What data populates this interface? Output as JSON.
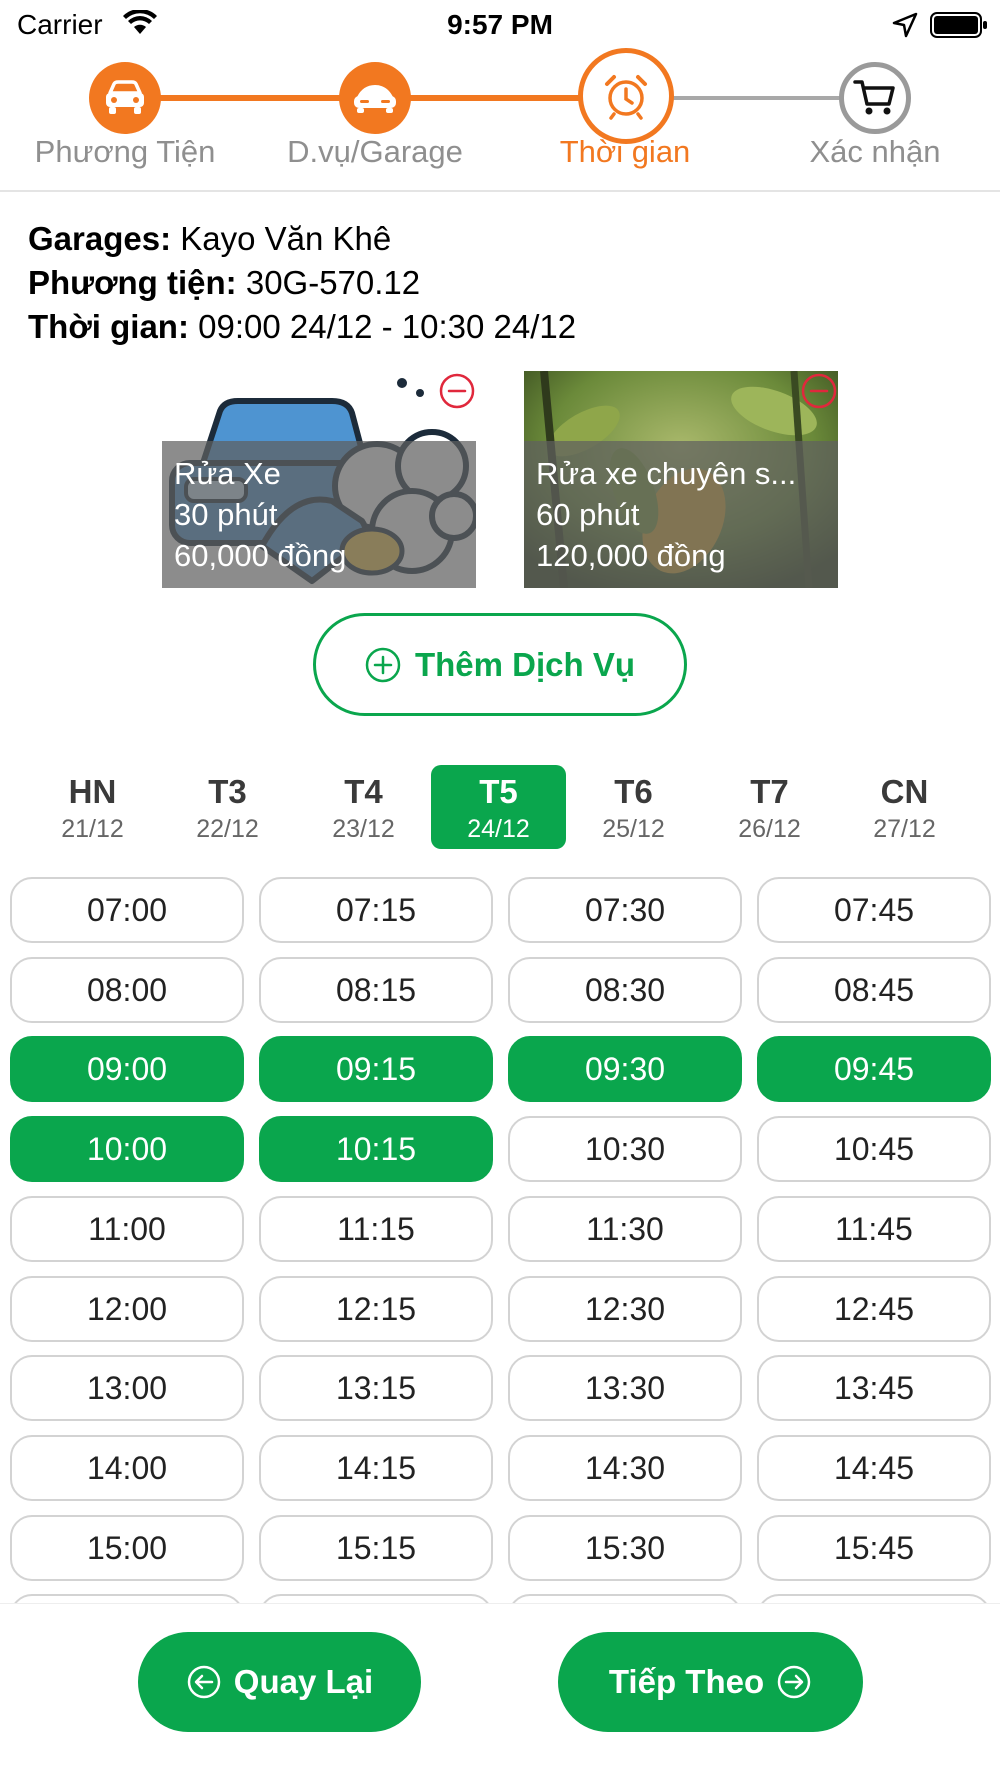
{
  "status_bar": {
    "carrier": "Carrier",
    "time": "9:57 PM"
  },
  "stepper": {
    "steps": [
      {
        "label": "Phương Tiện",
        "icon": "car-icon",
        "state": "done"
      },
      {
        "label": "D.vụ/Garage",
        "icon": "car-service-icon",
        "state": "done"
      },
      {
        "label": "Thời gian",
        "icon": "alarm-clock-icon",
        "state": "active"
      },
      {
        "label": "Xác nhận",
        "icon": "cart-icon",
        "state": "pending"
      }
    ],
    "colors": {
      "active": "#f27820",
      "pending": "#9a9a9a"
    }
  },
  "summary": {
    "garage_key": "Garages:",
    "garage_value": " Kayo Văn Khê",
    "vehicle_key": "Phương tiện:",
    "vehicle_value": " 30G-570.12",
    "time_key": "Thời gian:",
    "time_value": " 09:00 24/12 - 10:30 24/12"
  },
  "services": [
    {
      "name": "Rửa Xe",
      "duration": "30 phút",
      "price": "60,000 đồng",
      "image": "car-wash-illustration"
    },
    {
      "name": "Rửa xe chuyên s...",
      "duration": "60 phút",
      "price": "120,000 đồng",
      "image": "leaf-photo"
    }
  ],
  "add_service_label": "Thêm Dịch Vụ",
  "days": [
    {
      "name": "HN",
      "date": "21/12",
      "selected": false
    },
    {
      "name": "T3",
      "date": "22/12",
      "selected": false
    },
    {
      "name": "T4",
      "date": "23/12",
      "selected": false
    },
    {
      "name": "T5",
      "date": "24/12",
      "selected": true
    },
    {
      "name": "T6",
      "date": "25/12",
      "selected": false
    },
    {
      "name": "T7",
      "date": "26/12",
      "selected": false
    },
    {
      "name": "CN",
      "date": "27/12",
      "selected": false
    }
  ],
  "time_slots": [
    {
      "time": "07:00",
      "selected": false
    },
    {
      "time": "07:15",
      "selected": false
    },
    {
      "time": "07:30",
      "selected": false
    },
    {
      "time": "07:45",
      "selected": false
    },
    {
      "time": "08:00",
      "selected": false
    },
    {
      "time": "08:15",
      "selected": false
    },
    {
      "time": "08:30",
      "selected": false
    },
    {
      "time": "08:45",
      "selected": false
    },
    {
      "time": "09:00",
      "selected": true
    },
    {
      "time": "09:15",
      "selected": true
    },
    {
      "time": "09:30",
      "selected": true
    },
    {
      "time": "09:45",
      "selected": true
    },
    {
      "time": "10:00",
      "selected": true
    },
    {
      "time": "10:15",
      "selected": true
    },
    {
      "time": "10:30",
      "selected": false
    },
    {
      "time": "10:45",
      "selected": false
    },
    {
      "time": "11:00",
      "selected": false
    },
    {
      "time": "11:15",
      "selected": false
    },
    {
      "time": "11:30",
      "selected": false
    },
    {
      "time": "11:45",
      "selected": false
    },
    {
      "time": "12:00",
      "selected": false
    },
    {
      "time": "12:15",
      "selected": false
    },
    {
      "time": "12:30",
      "selected": false
    },
    {
      "time": "12:45",
      "selected": false
    },
    {
      "time": "13:00",
      "selected": false
    },
    {
      "time": "13:15",
      "selected": false
    },
    {
      "time": "13:30",
      "selected": false
    },
    {
      "time": "13:45",
      "selected": false
    },
    {
      "time": "14:00",
      "selected": false
    },
    {
      "time": "14:15",
      "selected": false
    },
    {
      "time": "14:30",
      "selected": false
    },
    {
      "time": "14:45",
      "selected": false
    },
    {
      "time": "15:00",
      "selected": false
    },
    {
      "time": "15:15",
      "selected": false
    },
    {
      "time": "15:30",
      "selected": false
    },
    {
      "time": "15:45",
      "selected": false
    },
    {
      "time": "",
      "selected": false
    },
    {
      "time": "",
      "selected": false
    },
    {
      "time": "",
      "selected": false
    },
    {
      "time": "",
      "selected": false
    }
  ],
  "buttons": {
    "back": "Quay Lại",
    "next": "Tiếp Theo"
  },
  "colors": {
    "primary_green": "#0aa64d",
    "accent_orange": "#f27820",
    "remove_red": "#e0283c"
  }
}
